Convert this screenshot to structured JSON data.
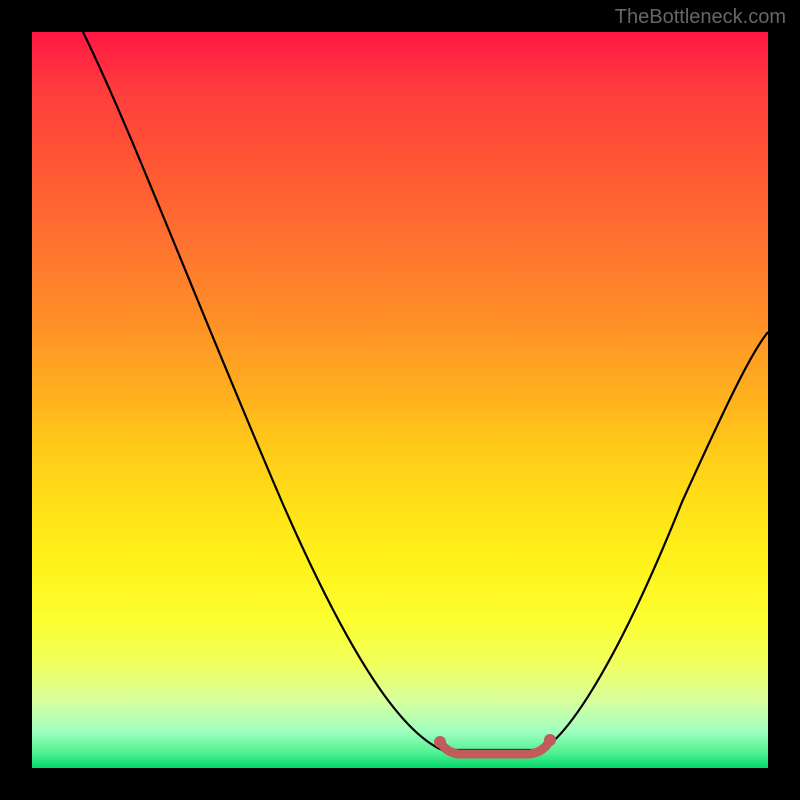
{
  "watermark": "TheBottleneck.com",
  "chart_data": {
    "type": "line",
    "title": "",
    "xlabel": "",
    "ylabel": "",
    "xlim": [
      0,
      100
    ],
    "ylim": [
      0,
      100
    ],
    "series": [
      {
        "name": "bottleneck-curve",
        "x": [
          7,
          14,
          22,
          30,
          38,
          46,
          52,
          56,
          58,
          60,
          64,
          68,
          70,
          74,
          80,
          88,
          96,
          100
        ],
        "values": [
          100,
          86,
          70,
          54,
          38,
          22,
          10,
          3,
          1,
          1,
          1,
          1,
          3,
          8,
          18,
          34,
          50,
          58
        ]
      }
    ],
    "annotations": {
      "flat_bottom_segment": {
        "x_start": 56,
        "x_end": 70,
        "color": "#c25b5b"
      }
    },
    "background": "rainbow-gradient-vertical"
  }
}
